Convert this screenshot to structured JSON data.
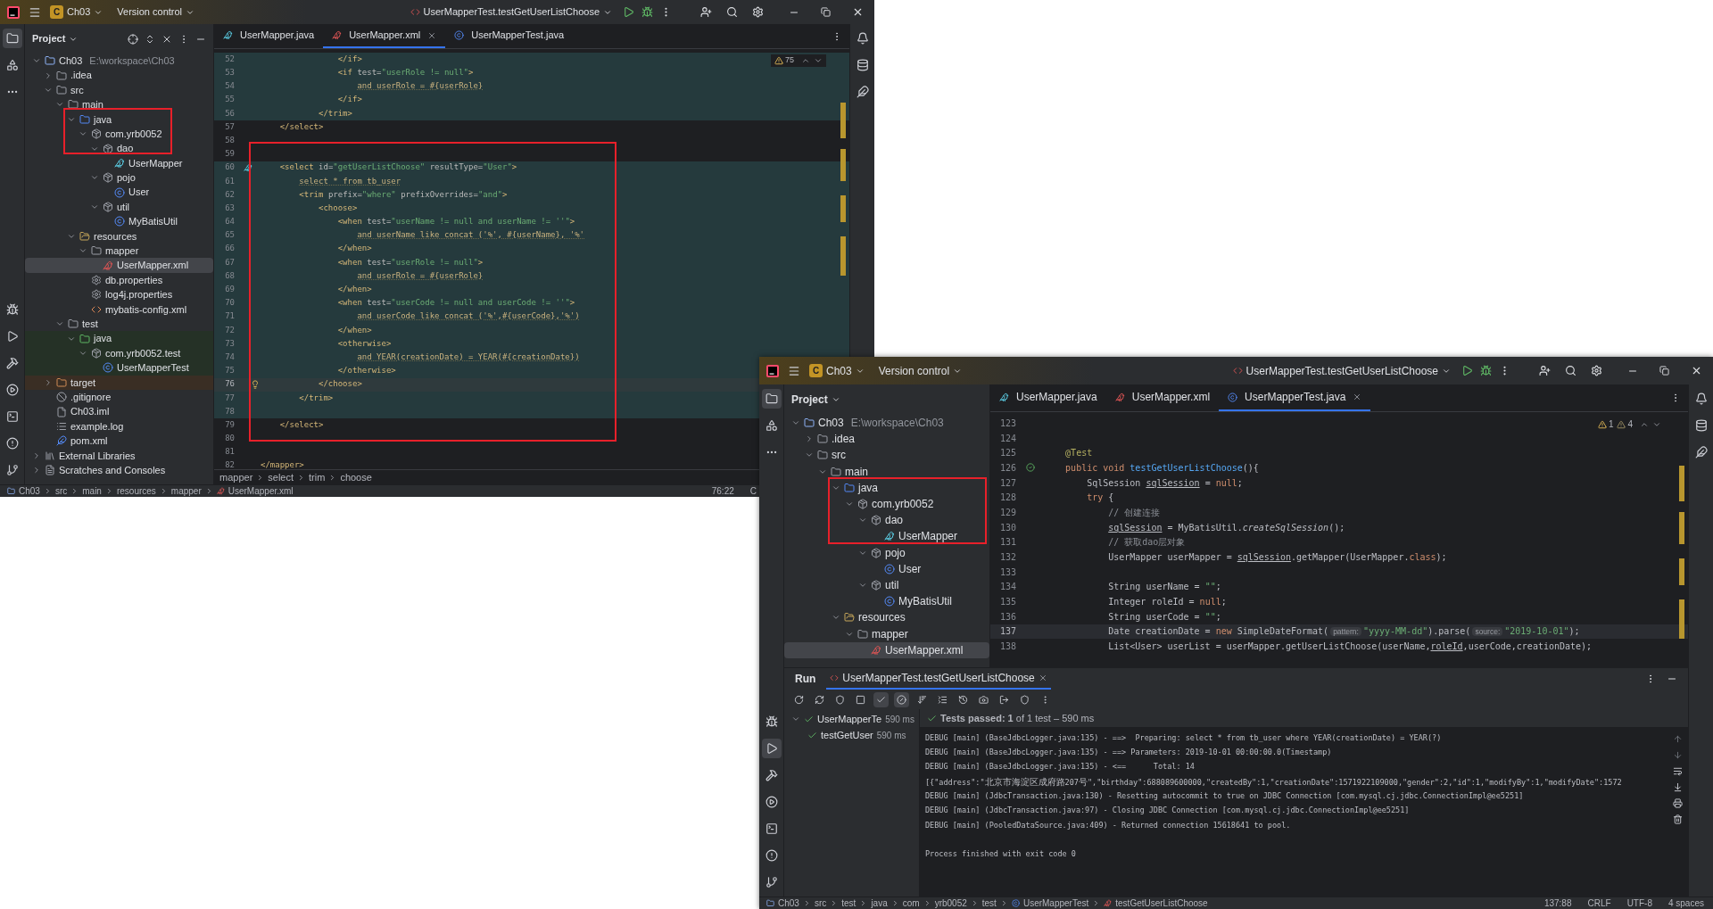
{
  "windows": [
    {
      "badge": "C",
      "project": "Ch03",
      "vcs": "Version control",
      "run_config": "UserMapperTest.testGetUserListChoose",
      "stripe_top": [
        {
          "kind": "project",
          "selected": true
        },
        {
          "kind": "structure",
          "selected": false
        },
        {
          "kind": "more",
          "selected": false
        }
      ],
      "stripe_bottom": [
        {
          "kind": "debug",
          "selected": false
        },
        {
          "kind": "run",
          "selected": false
        },
        {
          "kind": "build",
          "selected": false
        },
        {
          "kind": "services",
          "selected": false
        },
        {
          "kind": "terminal",
          "selected": false
        },
        {
          "kind": "problems",
          "selected": false
        },
        {
          "kind": "git",
          "selected": false
        }
      ],
      "stripe_right": [
        {
          "kind": "notifications"
        },
        {
          "kind": "database"
        },
        {
          "kind": "maven"
        }
      ],
      "panel_title": "Project",
      "panel_actions": [
        {
          "kind": "locate"
        },
        {
          "kind": "expand"
        },
        {
          "kind": "collapse"
        },
        {
          "kind": "more"
        },
        {
          "kind": "hide"
        }
      ],
      "tree": [
        {
          "label": "Ch03",
          "hint": "E:\\workspace\\Ch03",
          "kind": "module",
          "expanded": true,
          "selected": false,
          "children": [
            {
              "label": ".idea",
              "kind": "folder",
              "expanded": false,
              "selected": false
            },
            {
              "label": "src",
              "kind": "folder",
              "expanded": true,
              "selected": false,
              "children": [
                {
                  "label": "main",
                  "kind": "folder",
                  "expanded": true,
                  "selected": false,
                  "children": [
                    {
                      "label": "java",
                      "kind": "source",
                      "expanded": true,
                      "selected": false,
                      "children": [
                        {
                          "label": "com.yrb0052",
                          "kind": "package",
                          "expanded": true,
                          "selected": false,
                          "children": [
                            {
                              "label": "dao",
                              "kind": "package",
                              "expanded": true,
                              "selected": false,
                              "children": [
                                {
                                  "label": "UserMapper",
                                  "kind": "mapper",
                                  "selected": false
                                }
                              ]
                            },
                            {
                              "label": "pojo",
                              "kind": "package",
                              "expanded": true,
                              "selected": false,
                              "children": [
                                {
                                  "label": "User",
                                  "kind": "class",
                                  "selected": false
                                }
                              ]
                            },
                            {
                              "label": "util",
                              "kind": "package",
                              "expanded": true,
                              "selected": false,
                              "children": [
                                {
                                  "label": "MyBatisUtil",
                                  "kind": "class",
                                  "selected": false
                                }
                              ]
                            }
                          ]
                        }
                      ]
                    },
                    {
                      "label": "resources",
                      "kind": "resources",
                      "expanded": true,
                      "selected": false,
                      "children": [
                        {
                          "label": "mapper",
                          "kind": "folder",
                          "expanded": true,
                          "selected": false,
                          "children": [
                            {
                              "label": "UserMapper.xml",
                              "kind": "mapperxml",
                              "selected": true
                            }
                          ]
                        },
                        {
                          "label": "db.properties",
                          "kind": "properties",
                          "selected": false
                        },
                        {
                          "label": "log4j.properties",
                          "kind": "properties",
                          "selected": false
                        },
                        {
                          "label": "mybatis-config.xml",
                          "kind": "xml",
                          "selected": false
                        }
                      ]
                    }
                  ]
                },
                {
                  "label": "test",
                  "kind": "folder",
                  "expanded": true,
                  "selected": false,
                  "children": [
                    {
                      "label": "java",
                      "kind": "testroot",
                      "color": "#253126",
                      "expanded": true,
                      "selected": false,
                      "children": [
                        {
                          "label": "com.yrb0052.test",
                          "kind": "package",
                          "color": "#253126",
                          "expanded": true,
                          "selected": false,
                          "children": [
                            {
                              "label": "UserMapperTest",
                              "kind": "class",
                              "color": "#253126",
                              "selected": false
                            }
                          ]
                        }
                      ]
                    }
                  ]
                }
              ]
            },
            {
              "label": "target",
              "kind": "excluded",
              "color": "#3a2e24",
              "expanded": false,
              "selected": false
            },
            {
              "label": ".gitignore",
              "kind": "gitignore",
              "selected": false
            },
            {
              "label": "Ch03.iml",
              "kind": "iml",
              "selected": false
            },
            {
              "label": "example.log",
              "kind": "log",
              "selected": false
            },
            {
              "label": "pom.xml",
              "kind": "maven",
              "selected": false
            }
          ]
        },
        {
          "label": "External Libraries",
          "kind": "libraries",
          "expanded": false,
          "selected": false
        },
        {
          "label": "Scratches and Consoles",
          "kind": "scratches",
          "expanded": false,
          "selected": false
        }
      ],
      "tabs": [
        {
          "label": "UserMapper.java",
          "kind": "mapper",
          "selected": false
        },
        {
          "label": "UserMapper.xml",
          "kind": "mapperxml",
          "selected": true
        },
        {
          "label": "UserMapperTest.java",
          "kind": "class",
          "selected": false
        }
      ],
      "inspections": [
        {
          "kind": "warning",
          "count": "75"
        }
      ],
      "lines": [
        {
          "n": "52",
          "kind": "plain",
          "region": true,
          "current": false,
          "c": [
            {
              "kind": "tag",
              "text": "                </if>"
            }
          ]
        },
        {
          "n": "53",
          "kind": "plain",
          "region": true,
          "current": false,
          "c": [
            {
              "kind": "tag",
              "text": "                <if "
            },
            {
              "kind": "attr",
              "text": "test="
            },
            {
              "kind": "str",
              "text": "\"userRole != null\""
            },
            {
              "kind": "tag",
              "text": ">"
            }
          ]
        },
        {
          "n": "54",
          "kind": "plain",
          "region": true,
          "current": false,
          "c": [
            {
              "kind": "sql",
              "text": "                    and userRole = #{userRole}"
            }
          ]
        },
        {
          "n": "55",
          "kind": "plain",
          "region": true,
          "current": false,
          "c": [
            {
              "kind": "tag",
              "text": "                </if>"
            }
          ]
        },
        {
          "n": "56",
          "kind": "plain",
          "region": true,
          "current": false,
          "c": [
            {
              "kind": "tag",
              "text": "            </trim>"
            }
          ]
        },
        {
          "n": "57",
          "kind": "plain",
          "region": false,
          "current": false,
          "c": [
            {
              "kind": "tag",
              "text": "    </select>"
            }
          ]
        },
        {
          "n": "58",
          "kind": "plain",
          "region": false,
          "current": false
        },
        {
          "n": "59",
          "kind": "plain",
          "region": false,
          "current": false
        },
        {
          "n": "60",
          "kind": "mapper",
          "region": true,
          "current": false,
          "c": [
            {
              "kind": "tag",
              "text": "    <select "
            },
            {
              "kind": "attr",
              "text": "id="
            },
            {
              "kind": "str",
              "text": "\"getUserListChoose\""
            },
            {
              "kind": "attr",
              "text": " resultType="
            },
            {
              "kind": "str",
              "text": "\"User\""
            },
            {
              "kind": "tag",
              "text": ">"
            }
          ]
        },
        {
          "n": "61",
          "kind": "plain",
          "region": true,
          "current": false,
          "c": [
            {
              "kind": "sql",
              "text": "        select * from tb_user"
            }
          ]
        },
        {
          "n": "62",
          "kind": "plain",
          "region": true,
          "current": false,
          "c": [
            {
              "kind": "tag",
              "text": "        <trim "
            },
            {
              "kind": "attr",
              "text": "prefix="
            },
            {
              "kind": "str",
              "text": "\"where\""
            },
            {
              "kind": "attr",
              "text": " prefixOverrides="
            },
            {
              "kind": "str",
              "text": "\"and\""
            },
            {
              "kind": "tag",
              "text": ">"
            }
          ]
        },
        {
          "n": "63",
          "kind": "plain",
          "region": true,
          "current": false,
          "c": [
            {
              "kind": "tag",
              "text": "            <choose>"
            }
          ]
        },
        {
          "n": "64",
          "kind": "plain",
          "region": true,
          "current": false,
          "c": [
            {
              "kind": "tag",
              "text": "                <when "
            },
            {
              "kind": "attr",
              "text": "test="
            },
            {
              "kind": "str",
              "text": "\"userName != null and userName != ''\""
            },
            {
              "kind": "tag",
              "text": ">"
            }
          ]
        },
        {
          "n": "65",
          "kind": "plain",
          "region": true,
          "current": false,
          "c": [
            {
              "kind": "sql",
              "text": "                    and userName like concat ('%', #{userName}, '%'"
            }
          ]
        },
        {
          "n": "66",
          "kind": "plain",
          "region": true,
          "current": false,
          "c": [
            {
              "kind": "tag",
              "text": "                </when>"
            }
          ]
        },
        {
          "n": "67",
          "kind": "plain",
          "region": true,
          "current": false,
          "c": [
            {
              "kind": "tag",
              "text": "                <when "
            },
            {
              "kind": "attr",
              "text": "test="
            },
            {
              "kind": "str",
              "text": "\"userRole != null\""
            },
            {
              "kind": "tag",
              "text": ">"
            }
          ]
        },
        {
          "n": "68",
          "kind": "plain",
          "region": true,
          "current": false,
          "c": [
            {
              "kind": "sql",
              "text": "                    and userRole = #{userRole}"
            }
          ]
        },
        {
          "n": "69",
          "kind": "plain",
          "region": true,
          "current": false,
          "c": [
            {
              "kind": "tag",
              "text": "                </when>"
            }
          ]
        },
        {
          "n": "70",
          "kind": "plain",
          "region": true,
          "current": false,
          "c": [
            {
              "kind": "tag",
              "text": "                <when "
            },
            {
              "kind": "attr",
              "text": "test="
            },
            {
              "kind": "str",
              "text": "\"userCode != null and userCode != ''\""
            },
            {
              "kind": "tag",
              "text": ">"
            }
          ]
        },
        {
          "n": "71",
          "kind": "plain",
          "region": true,
          "current": false,
          "c": [
            {
              "kind": "sql",
              "text": "                    and userCode like concat ('%',#{userCode},'%')"
            }
          ]
        },
        {
          "n": "72",
          "kind": "plain",
          "region": true,
          "current": false,
          "c": [
            {
              "kind": "tag",
              "text": "                </when>"
            }
          ]
        },
        {
          "n": "73",
          "kind": "plain",
          "region": true,
          "current": false,
          "c": [
            {
              "kind": "tag",
              "text": "                <otherwise>"
            }
          ]
        },
        {
          "n": "74",
          "kind": "plain",
          "region": true,
          "current": false,
          "c": [
            {
              "kind": "sql",
              "text": "                    and YEAR(creationDate) = YEAR(#{creationDate})"
            }
          ]
        },
        {
          "n": "75",
          "kind": "plain",
          "region": true,
          "current": false,
          "c": [
            {
              "kind": "tag",
              "text": "                </otherwise>"
            }
          ]
        },
        {
          "n": "76",
          "kind": "bulb",
          "region": true,
          "current": true,
          "c": [
            {
              "kind": "tag",
              "text": "            </choose>"
            }
          ]
        },
        {
          "n": "77",
          "kind": "plain",
          "region": true,
          "current": false,
          "c": [
            {
              "kind": "tag",
              "text": "        </trim>"
            }
          ]
        },
        {
          "n": "78",
          "kind": "plain",
          "region": true,
          "current": false
        },
        {
          "n": "79",
          "kind": "plain",
          "region": false,
          "current": false,
          "c": [
            {
              "kind": "tag",
              "text": "    </select>"
            }
          ]
        },
        {
          "n": "80",
          "kind": "plain",
          "region": false,
          "current": false
        },
        {
          "n": "81",
          "kind": "plain",
          "region": false,
          "current": false
        },
        {
          "n": "82",
          "kind": "plain",
          "region": false,
          "current": false,
          "c": [
            {
              "kind": "tag",
              "text": "</mapper>"
            }
          ]
        }
      ],
      "breadcrumbs": [
        "mapper",
        "select",
        "trim",
        "choose"
      ],
      "status_path": [
        {
          "label": "Ch03",
          "kind": "module"
        },
        {
          "label": "src",
          "kind": "plain"
        },
        {
          "label": "main",
          "kind": "plain"
        },
        {
          "label": "resources",
          "kind": "plain"
        },
        {
          "label": "mapper",
          "kind": "plain"
        },
        {
          "label": "UserMapper.xml",
          "kind": "mapperxml"
        }
      ],
      "status_items": [
        "76:22",
        "C"
      ]
    },
    {
      "badge": "C",
      "project": "Ch03",
      "vcs": "Version control",
      "run_config": "UserMapperTest.testGetUserListChoose",
      "stripe_top": [
        {
          "kind": "project",
          "selected": true
        },
        {
          "kind": "structure",
          "selected": false
        },
        {
          "kind": "more",
          "selected": false
        }
      ],
      "stripe_bottom": [
        {
          "kind": "debug",
          "selected": false
        },
        {
          "kind": "run",
          "selected": true
        },
        {
          "kind": "build",
          "selected": false
        },
        {
          "kind": "services",
          "selected": false
        },
        {
          "kind": "terminal",
          "selected": false
        },
        {
          "kind": "problems",
          "selected": false
        },
        {
          "kind": "git",
          "selected": false
        }
      ],
      "stripe_right": [
        {
          "kind": "notifications"
        },
        {
          "kind": "database"
        },
        {
          "kind": "maven"
        }
      ],
      "panel_title": "Project",
      "tree": [
        {
          "label": "Ch03",
          "hint": "E:\\workspace\\Ch03",
          "kind": "module",
          "expanded": true,
          "selected": false,
          "children": [
            {
              "label": ".idea",
              "kind": "folder",
              "expanded": false,
              "selected": false
            },
            {
              "label": "src",
              "kind": "folder",
              "expanded": true,
              "selected": false,
              "children": [
                {
                  "label": "main",
                  "kind": "folder",
                  "expanded": true,
                  "selected": false,
                  "children": [
                    {
                      "label": "java",
                      "kind": "source",
                      "expanded": true,
                      "selected": false,
                      "children": [
                        {
                          "label": "com.yrb0052",
                          "kind": "package",
                          "expanded": true,
                          "selected": false,
                          "children": [
                            {
                              "label": "dao",
                              "kind": "package",
                              "expanded": true,
                              "selected": false,
                              "children": [
                                {
                                  "label": "UserMapper",
                                  "kind": "mapper",
                                  "selected": false
                                }
                              ]
                            },
                            {
                              "label": "pojo",
                              "kind": "package",
                              "expanded": true,
                              "selected": false,
                              "children": [
                                {
                                  "label": "User",
                                  "kind": "class",
                                  "selected": false
                                }
                              ]
                            },
                            {
                              "label": "util",
                              "kind": "package",
                              "expanded": true,
                              "selected": false,
                              "children": [
                                {
                                  "label": "MyBatisUtil",
                                  "kind": "class",
                                  "selected": false
                                }
                              ]
                            }
                          ]
                        }
                      ]
                    },
                    {
                      "label": "resources",
                      "kind": "resources",
                      "expanded": true,
                      "selected": false,
                      "children": [
                        {
                          "label": "mapper",
                          "kind": "folder",
                          "expanded": true,
                          "selected": false,
                          "children": [
                            {
                              "label": "UserMapper.xml",
                              "kind": "mapperxml",
                              "selected": true
                            }
                          ]
                        }
                      ]
                    }
                  ]
                }
              ]
            }
          ]
        }
      ],
      "tabs": [
        {
          "label": "UserMapper.java",
          "kind": "mapper",
          "selected": false
        },
        {
          "label": "UserMapper.xml",
          "kind": "mapperxml",
          "selected": false
        },
        {
          "label": "UserMapperTest.java",
          "kind": "class",
          "selected": true
        }
      ],
      "inspections": [
        {
          "kind": "warning",
          "count": "1"
        },
        {
          "kind": "weak",
          "count": "4"
        }
      ],
      "lines": [
        {
          "n": "123",
          "kind": "plain",
          "region": false,
          "current": false
        },
        {
          "n": "124",
          "kind": "plain",
          "region": false,
          "current": false
        },
        {
          "n": "125",
          "kind": "plain",
          "region": false,
          "current": false,
          "c": [
            {
              "kind": "annot",
              "text": "    @Test"
            }
          ]
        },
        {
          "n": "126",
          "kind": "test",
          "region": false,
          "current": false,
          "c": [
            {
              "kind": "keyword",
              "text": "    public void "
            },
            {
              "kind": "func",
              "text": "testGetUserListChoose"
            },
            {
              "kind": "plain",
              "text": "(){"
            }
          ]
        },
        {
          "n": "127",
          "kind": "plain",
          "region": false,
          "current": false,
          "c": [
            {
              "kind": "plain",
              "text": "        SqlSession "
            },
            {
              "kind": "under",
              "text": "sqlSession"
            },
            {
              "kind": "plain",
              "text": " = "
            },
            {
              "kind": "keyword",
              "text": "null"
            },
            {
              "kind": "plain",
              "text": ";"
            }
          ]
        },
        {
          "n": "128",
          "kind": "plain",
          "region": false,
          "current": false,
          "c": [
            {
              "kind": "keyword",
              "text": "        try"
            },
            {
              "kind": "plain",
              "text": " {"
            }
          ]
        },
        {
          "n": "129",
          "kind": "plain",
          "region": false,
          "current": false,
          "c": [
            {
              "kind": "comment",
              "text": "            // 创建连接"
            }
          ]
        },
        {
          "n": "130",
          "kind": "plain",
          "region": false,
          "current": false,
          "c": [
            {
              "kind": "under",
              "text": "            sqlSession"
            },
            {
              "kind": "plain",
              "text": " = MyBatisUtil."
            },
            {
              "kind": "italic",
              "text": "createSqlSession"
            },
            {
              "kind": "plain",
              "text": "();"
            }
          ]
        },
        {
          "n": "131",
          "kind": "plain",
          "region": false,
          "current": false,
          "c": [
            {
              "kind": "comment",
              "text": "            // 获取dao层对象"
            }
          ]
        },
        {
          "n": "132",
          "kind": "plain",
          "region": false,
          "current": false,
          "c": [
            {
              "kind": "plain",
              "text": "            UserMapper userMapper = "
            },
            {
              "kind": "under",
              "text": "sqlSession"
            },
            {
              "kind": "plain",
              "text": ".getMapper(UserMapper."
            },
            {
              "kind": "keyword",
              "text": "class"
            },
            {
              "kind": "plain",
              "text": ");"
            }
          ]
        },
        {
          "n": "133",
          "kind": "plain",
          "region": false,
          "current": false
        },
        {
          "n": "134",
          "kind": "plain",
          "region": false,
          "current": false,
          "c": [
            {
              "kind": "plain",
              "text": "            String userName = "
            },
            {
              "kind": "str",
              "text": "\"\""
            },
            {
              "kind": "plain",
              "text": ";"
            }
          ]
        },
        {
          "n": "135",
          "kind": "plain",
          "region": false,
          "current": false,
          "c": [
            {
              "kind": "plain",
              "text": "            Integer roleId = "
            },
            {
              "kind": "keyword",
              "text": "null"
            },
            {
              "kind": "plain",
              "text": ";"
            }
          ]
        },
        {
          "n": "136",
          "kind": "plain",
          "region": false,
          "current": false,
          "c": [
            {
              "kind": "plain",
              "text": "            String userCode = "
            },
            {
              "kind": "str",
              "text": "\"\""
            },
            {
              "kind": "plain",
              "text": ";"
            }
          ]
        },
        {
          "n": "137",
          "kind": "plain",
          "region": false,
          "current": true,
          "c": [
            {
              "kind": "plain",
              "text": "            Date creationDate = "
            },
            {
              "kind": "keyword",
              "text": "new"
            },
            {
              "kind": "plain",
              "text": " SimpleDateFormat("
            },
            {
              "kind": "hint",
              "text": "pattern:"
            },
            {
              "kind": "str",
              "text": "\"yyyy-MM-dd\""
            },
            {
              "kind": "plain",
              "text": ").parse("
            },
            {
              "kind": "hint",
              "text": "source:"
            },
            {
              "kind": "str",
              "text": "\"2019-10-01\""
            },
            {
              "kind": "plain",
              "text": ");"
            }
          ]
        },
        {
          "n": "138",
          "kind": "plain",
          "region": false,
          "current": false,
          "c": [
            {
              "kind": "plain",
              "text": "            List<User> userList = userMapper.getUserListChoose(userName,"
            },
            {
              "kind": "under",
              "text": "roleId"
            },
            {
              "kind": "plain",
              "text": ",userCode,creationDate);"
            }
          ]
        }
      ],
      "run": {
        "label": "Run",
        "tab": "UserMapperTest.testGetUserListChoose",
        "toolbar": [
          {
            "kind": "rerun",
            "selected": false
          },
          {
            "kind": "rerunfailed",
            "selected": false
          },
          {
            "kind": "auto",
            "selected": false
          },
          {
            "kind": "stop",
            "selected": false
          },
          {
            "kind": "passed",
            "selected": true
          },
          {
            "kind": "ignored",
            "selected": true
          },
          {
            "kind": "sort",
            "selected": false
          },
          {
            "kind": "collapse",
            "selected": false
          },
          {
            "kind": "history",
            "selected": false
          },
          {
            "kind": "snapshot",
            "selected": false
          },
          {
            "kind": "export",
            "selected": false
          },
          {
            "kind": "coverage",
            "selected": false
          },
          {
            "kind": "more",
            "selected": false
          }
        ],
        "tree": [
          {
            "label": "UserMapperTe",
            "time": "590 ms",
            "expanded": true,
            "selected": false,
            "children": [
              {
                "label": "testGetUser",
                "time": "590 ms",
                "selected": false
              }
            ]
          }
        ],
        "summary": "**Tests passed: 1** of 1 test – 590 ms",
        "console": [
          "DEBUG [main] (BaseJdbcLogger.java:135) - ==>  Preparing: select * from tb_user where YEAR(creationDate) = YEAR(?)",
          "DEBUG [main] (BaseJdbcLogger.java:135) - ==> Parameters: 2019-10-01 00:00:00.0(Timestamp)",
          "DEBUG [main] (BaseJdbcLogger.java:135) - <==      Total: 14",
          "[{\"address\":\"北京市海淀区成府路207号\",\"birthday\":688089600000,\"createdBy\":1,\"creationDate\":1571922109000,\"gender\":2,\"id\":1,\"modifyBy\":1,\"modifyDate\":1572",
          "DEBUG [main] (JdbcTransaction.java:130) - Resetting autocommit to true on JDBC Connection [com.mysql.cj.jdbc.ConnectionImpl@ee5251]",
          "DEBUG [main] (JdbcTransaction.java:97) - Closing JDBC Connection [com.mysql.cj.jdbc.ConnectionImpl@ee5251]",
          "DEBUG [main] (PooledDataSource.java:409) - Returned connection 15618641 to pool."
        ],
        "exit": "Process finished with exit code 0"
      },
      "status_path": [
        {
          "label": "Ch03",
          "kind": "module"
        },
        {
          "label": "src",
          "kind": "plain"
        },
        {
          "label": "test",
          "kind": "plain"
        },
        {
          "label": "java",
          "kind": "plain"
        },
        {
          "label": "com",
          "kind": "plain"
        },
        {
          "label": "yrb0052",
          "kind": "plain"
        },
        {
          "label": "test",
          "kind": "plain"
        },
        {
          "label": "UserMapperTest",
          "kind": "class"
        },
        {
          "label": "testGetUserListChoose",
          "kind": "mapperxml"
        }
      ],
      "status_items": [
        "137:88",
        "CRLF",
        "UTF-8",
        "4 spaces"
      ]
    }
  ]
}
